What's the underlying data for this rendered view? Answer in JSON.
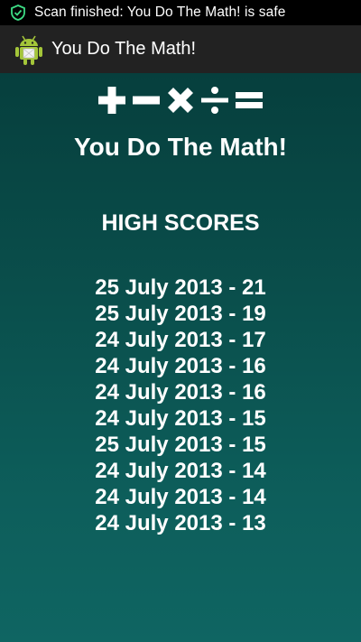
{
  "status_bar": {
    "notification_icon": "shield-check-icon",
    "notification_text": "Scan finished: You Do The Math! is safe"
  },
  "action_bar": {
    "app_icon": "android-robot-icon",
    "title": "You Do The Math!"
  },
  "main": {
    "math_symbols": [
      "plus-icon",
      "minus-icon",
      "multiply-icon",
      "divide-icon",
      "equals-icon"
    ],
    "app_heading": "You Do The Math!",
    "section_title": "HIGH SCORES",
    "scores": [
      "25 July 2013 - 21",
      "25 July 2013 - 19",
      "24 July 2013 - 17",
      "24 July 2013 - 16",
      "24 July 2013 - 16",
      "24 July 2013 - 15",
      "25 July 2013 - 15",
      "24 July 2013 - 14",
      "24 July 2013 - 14",
      "24 July 2013 - 13"
    ]
  },
  "colors": {
    "status_bar_bg": "#000000",
    "action_bar_bg": "#222222",
    "content_gradient_top": "#063f3d",
    "content_gradient_bottom": "#0f6562",
    "text": "#ffffff",
    "shield_green": "#4caf50",
    "android_green": "#a4c639"
  }
}
